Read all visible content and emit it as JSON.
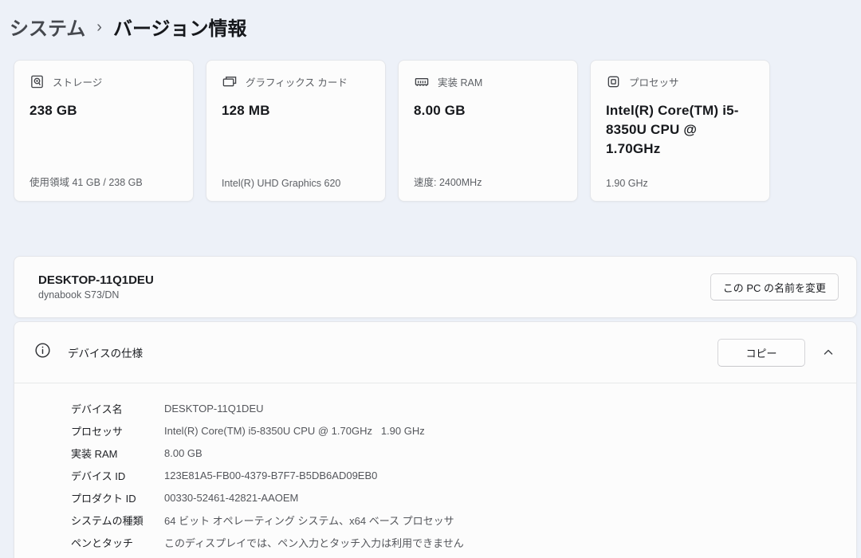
{
  "breadcrumb": {
    "parent": "システム",
    "separator": "›",
    "current": "バージョン情報"
  },
  "cards": [
    {
      "icon": "storage-icon",
      "title": "ストレージ",
      "value": "238 GB",
      "subtitle": "使用領域 41 GB / 238 GB"
    },
    {
      "icon": "graphics-card-icon",
      "title": "グラフィックス カード",
      "value": "128 MB",
      "subtitle": "Intel(R) UHD Graphics 620"
    },
    {
      "icon": "ram-icon",
      "title": "実装 RAM",
      "value": "8.00 GB",
      "subtitle": "速度: 2400MHz"
    },
    {
      "icon": "processor-icon",
      "title": "プロセッサ",
      "value": "Intel(R) Core(TM) i5-8350U CPU @ 1.70GHz",
      "subtitle": "1.90 GHz"
    }
  ],
  "device_panel": {
    "name": "DESKTOP-11Q1DEU",
    "model": "dynabook S73/DN",
    "rename_button": "この PC の名前を変更"
  },
  "specs_panel": {
    "title": "デバイスの仕様",
    "copy_button": "コピー",
    "collapse_icon": "chevron-up-icon",
    "rows": [
      {
        "label": "デバイス名",
        "value": "DESKTOP-11Q1DEU"
      },
      {
        "label": "プロセッサ",
        "value": "Intel(R) Core(TM) i5-8350U CPU @ 1.70GHz   1.90 GHz"
      },
      {
        "label": "実装 RAM",
        "value": "8.00 GB"
      },
      {
        "label": "デバイス ID",
        "value": "123E81A5-FB00-4379-B7F7-B5DB6AD09EB0"
      },
      {
        "label": "プロダクト ID",
        "value": "00330-52461-42821-AAOEM"
      },
      {
        "label": "システムの種類",
        "value": "64 ビット オペレーティング システム、x64 ベース プロセッサ"
      },
      {
        "label": "ペンとタッチ",
        "value": "このディスプレイでは、ペン入力とタッチ入力は利用できません"
      }
    ]
  },
  "colors": {
    "page_background": "#edf1f8",
    "card_background": "#fcfcfc",
    "card_border": "#e4e6ea",
    "primary_text": "#17191d",
    "secondary_text": "#5d6065"
  }
}
